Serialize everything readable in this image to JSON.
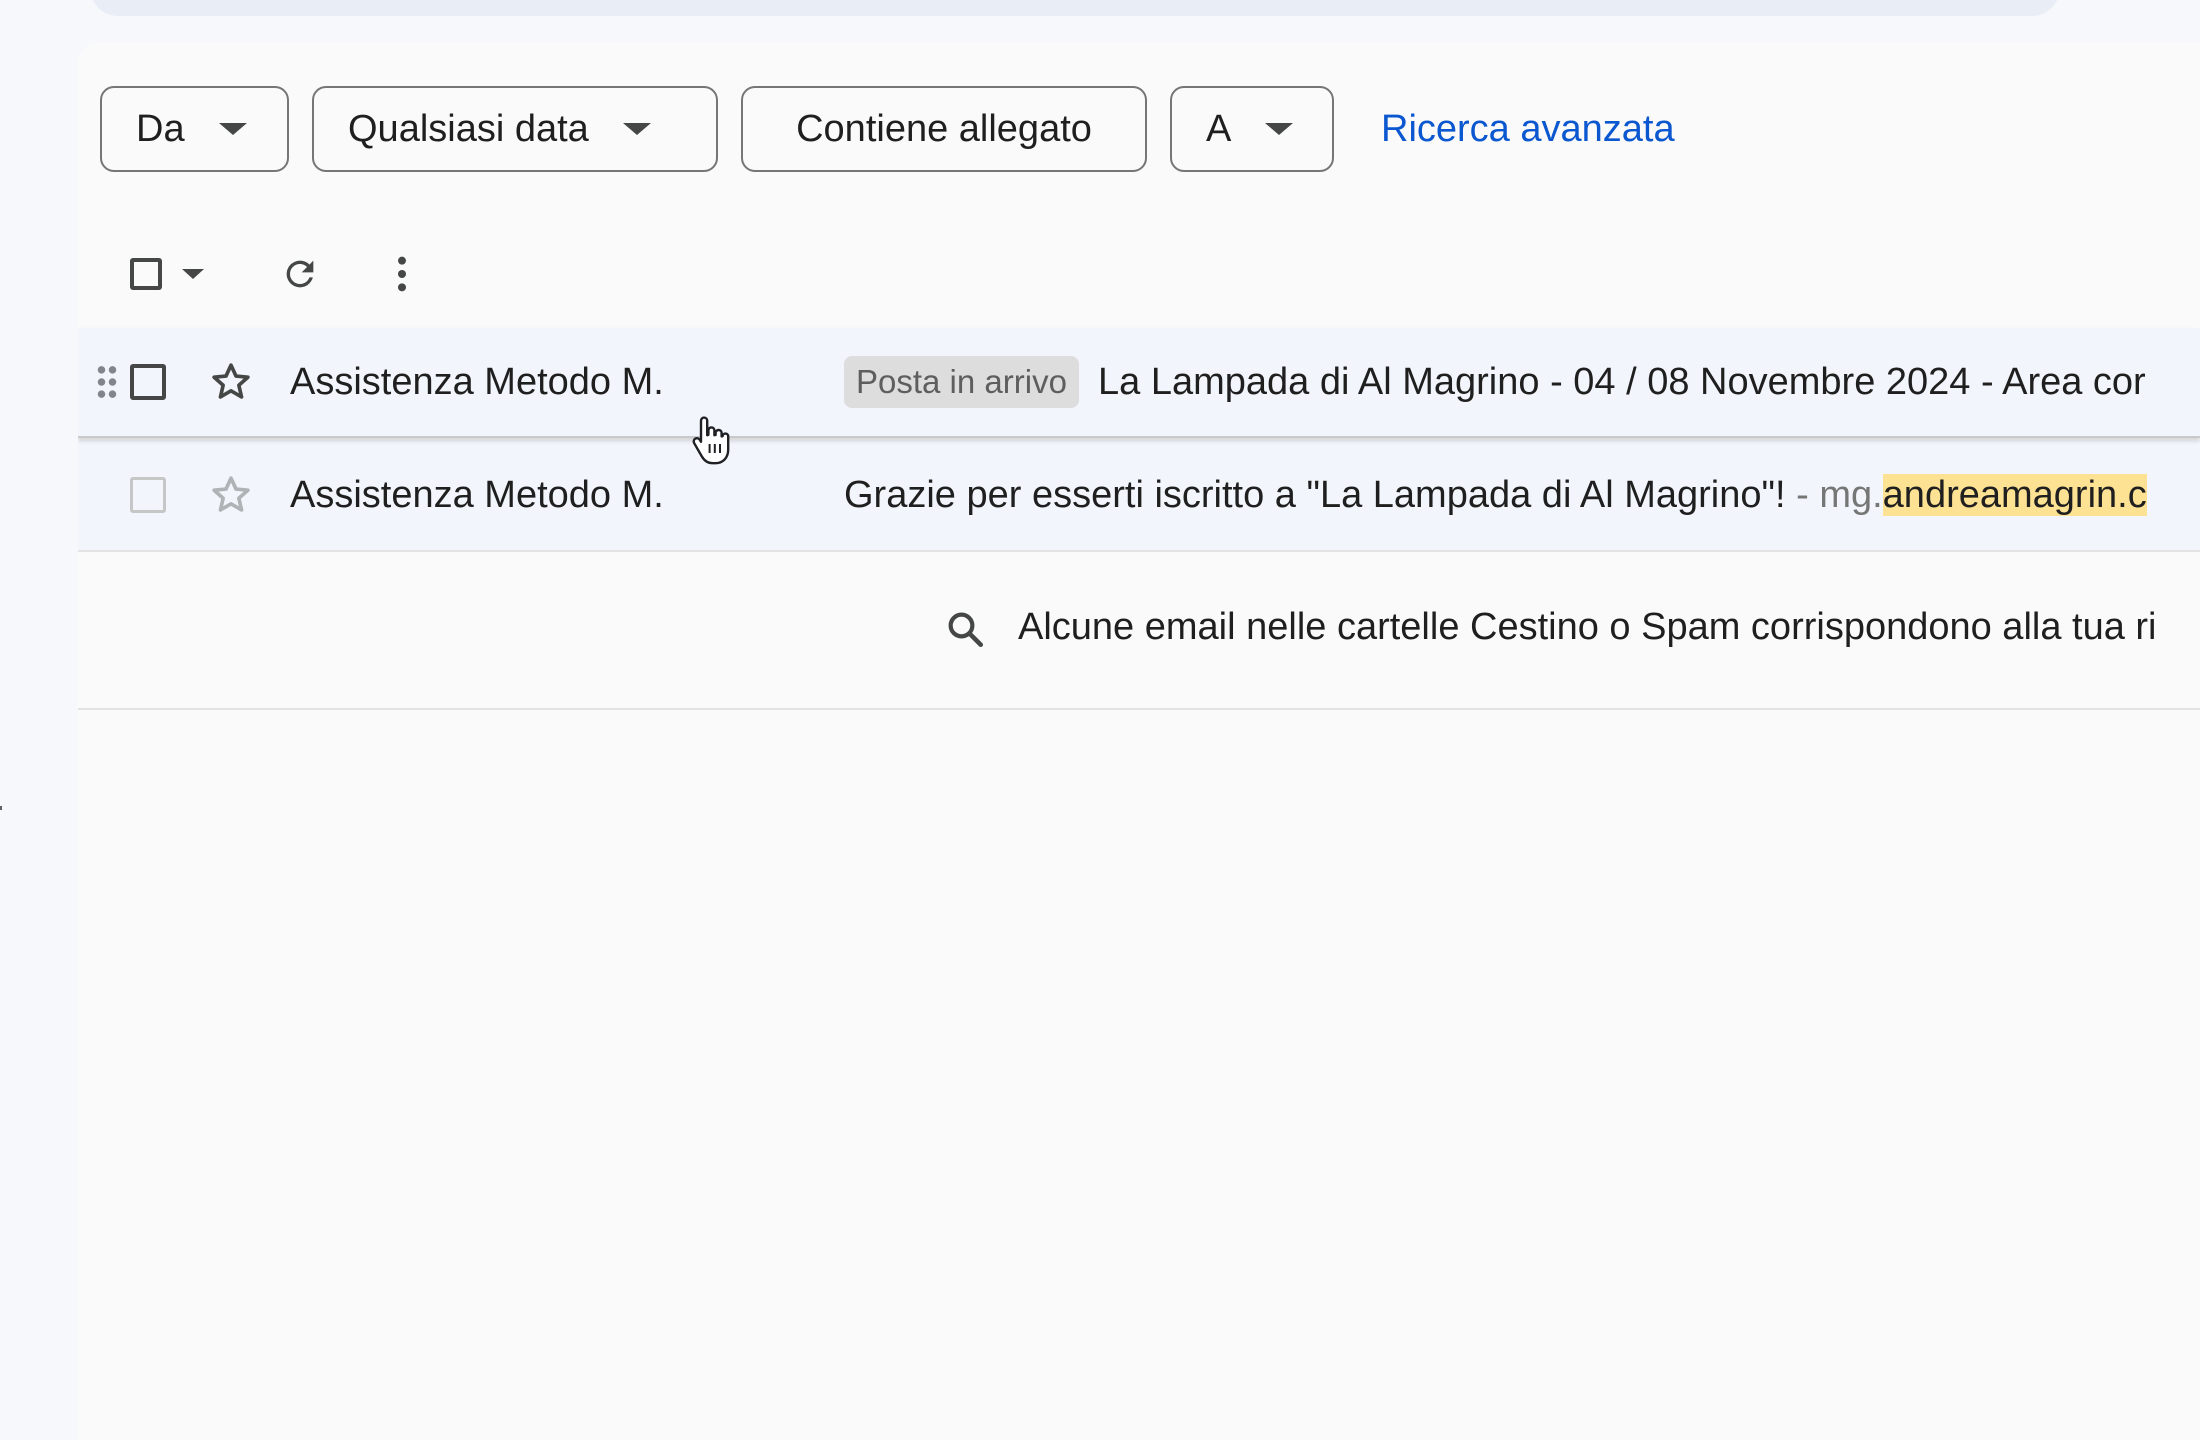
{
  "filters": {
    "from_label": "Da",
    "date_label": "Qualsiasi data",
    "attachment_label": "Contiene allegato",
    "to_label": "A",
    "advanced_search_label": "Ricerca avanzata"
  },
  "toolbar": {
    "select_icon": "checkbox-icon",
    "select_menu_icon": "caret-down-icon",
    "refresh_icon": "refresh-icon",
    "more_icon": "more-vert-icon"
  },
  "emails": [
    {
      "sender": "Assistenza Metodo M.",
      "label": "Posta in arrivo",
      "subject": "La Lampada di Al Magrino - 04 / 08 Novembre 2024 - Area cor",
      "starred": false
    },
    {
      "sender": "Assistenza Metodo M.",
      "subject": "Grazie per esserti iscritto a \"La Lampada di Al Magrino\"!",
      "separator": " - ",
      "snippet_prefix": "mg.",
      "snippet_highlight": "andreamagrin",
      "snippet_rest": ".c",
      "starred": false
    }
  ],
  "notice": {
    "icon": "search-icon",
    "text": "Alcune email nelle cartelle Cestino o Spam corrispondono alla tua ri"
  },
  "colors": {
    "link": "#0b57d0",
    "row_bg": "#f2f6fc",
    "highlight": "#fde293",
    "badge_bg": "#dddddd"
  }
}
